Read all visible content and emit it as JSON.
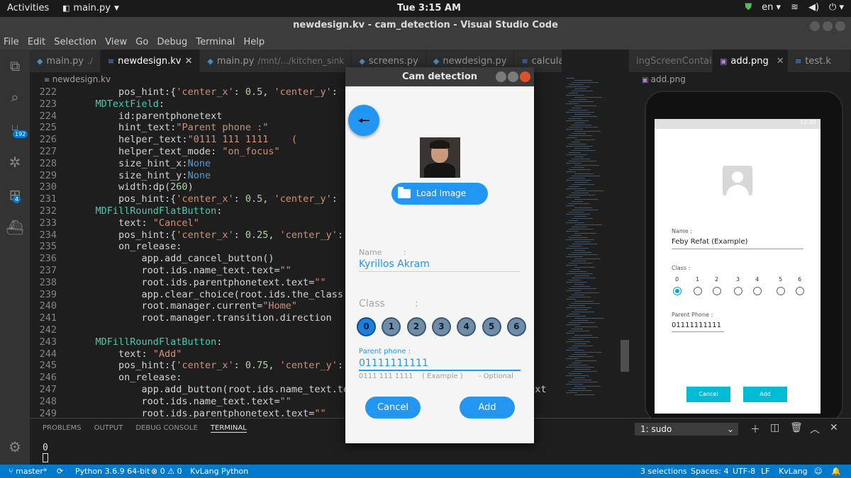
{
  "topbar": {
    "activities": "Activities",
    "app_name": "main.py",
    "clock": "Tue  3:15 AM",
    "language": "en"
  },
  "window": {
    "title": "newdesign.kv - cam_detection - Visual Studio Code"
  },
  "menu": [
    "File",
    "Edit",
    "Selection",
    "View",
    "Go",
    "Debug",
    "Terminal",
    "Help"
  ],
  "activity_badges": {
    "source_control": "192",
    "extensions": "4"
  },
  "tabs": [
    {
      "label": "main.py",
      "suffix": "./",
      "icon": "python-icon"
    },
    {
      "label": "newdesign.kv",
      "suffix": "",
      "icon": "kv-icon",
      "active": true
    },
    {
      "label": "main.py",
      "suffix": "/mnt/.../kitchen_sink",
      "icon": "python-icon"
    },
    {
      "label": "screens.py",
      "suffix": "",
      "icon": "python-icon"
    },
    {
      "label": "newdesign.py",
      "suffix": "",
      "icon": "python-icon"
    },
    {
      "label": "calculator.kv",
      "suffix": "",
      "icon": "kv-icon"
    }
  ],
  "breadcrumb": "newdesign.kv",
  "editor": {
    "lines": [
      {
        "n": "222",
        "indent": 8,
        "text": "pos_hint:{'center_x': 0.5, 'center_y':"
      },
      {
        "n": "223",
        "indent": 4,
        "text": "MDTextField:"
      },
      {
        "n": "224",
        "indent": 8,
        "text": "id:parentphonetext"
      },
      {
        "n": "225",
        "indent": 8,
        "text": "hint_text:\"Parent phone :\""
      },
      {
        "n": "226",
        "indent": 8,
        "text": "helper_text:\"0111 111 1111    ("
      },
      {
        "n": "227",
        "indent": 8,
        "text": "helper_text_mode: \"on_focus\""
      },
      {
        "n": "228",
        "indent": 8,
        "text": "size_hint_x:None"
      },
      {
        "n": "229",
        "indent": 8,
        "text": "size_hint_y:None"
      },
      {
        "n": "230",
        "indent": 8,
        "text": "width:dp(260)"
      },
      {
        "n": "231",
        "indent": 8,
        "text": "pos_hint:{'center_x': 0.5, 'center_y':"
      },
      {
        "n": "232",
        "indent": 4,
        "text": "MDFillRoundFlatButton:"
      },
      {
        "n": "233",
        "indent": 8,
        "text": "text: \"Cancel\""
      },
      {
        "n": "234",
        "indent": 8,
        "text": "pos_hint:{'center_x': 0.25, 'center_y':"
      },
      {
        "n": "235",
        "indent": 8,
        "text": "on_release:"
      },
      {
        "n": "236",
        "indent": 12,
        "text": "app.add_cancel_button()"
      },
      {
        "n": "237",
        "indent": 12,
        "text": "root.ids.name_text.text=\"\""
      },
      {
        "n": "238",
        "indent": 12,
        "text": "root.ids.parentphonetext.text=\"\""
      },
      {
        "n": "239",
        "indent": 12,
        "text": "app.clear_choice(root.ids.the_class"
      },
      {
        "n": "240",
        "indent": 12,
        "text": "root.manager.current=\"Home\""
      },
      {
        "n": "241",
        "indent": 12,
        "text": "root.manager.transition.direction"
      },
      {
        "n": "242",
        "indent": 0,
        "text": ""
      },
      {
        "n": "243",
        "indent": 4,
        "text": "MDFillRoundFlatButton:"
      },
      {
        "n": "244",
        "indent": 8,
        "text": "text: \"Add\""
      },
      {
        "n": "245",
        "indent": 8,
        "text": "pos_hint:{'center_x': 0.75, 'center_y':"
      },
      {
        "n": "246",
        "indent": 8,
        "text": "on_release:"
      },
      {
        "n": "247",
        "indent": 12,
        "text": "app.add_button(root.ids.name_text.text"
      },
      {
        "n": "248",
        "indent": 12,
        "text": "root.ids.name_text.text=\"\""
      },
      {
        "n": "249",
        "indent": 12,
        "text": "root.ids.parentphonetext.text=\"\""
      }
    ],
    "overflow_text": "text"
  },
  "right_pane": {
    "tabs": [
      {
        "label": "ingScreenContaint",
        "icon": ""
      },
      {
        "label": "add.png",
        "icon": "image-icon",
        "active": true
      },
      {
        "label": "test.k",
        "icon": "kv-icon"
      }
    ],
    "breadcrumb": "add.png",
    "preview": {
      "status_time": "12:30",
      "name_label": "Name :",
      "name_value": "Feby Refat (Example)",
      "class_label": "Class :",
      "class_numbers": [
        "0",
        "1",
        "2",
        "3",
        "4",
        "5",
        "6"
      ],
      "selected_class": "0",
      "phone_label": "Parent Phone :",
      "phone_value": "01111111111",
      "cancel": "Cancel",
      "add": "Add"
    }
  },
  "panel": {
    "tabs": [
      "PROBLEMS",
      "OUTPUT",
      "DEBUG CONSOLE",
      "TERMINAL"
    ],
    "active_tab": "TERMINAL",
    "terminal_select": "1: sudo",
    "terminal_output": "0"
  },
  "statusbar": {
    "branch": "master*",
    "python": "Python 3.6.9 64-bit",
    "errors": "0",
    "warnings": "0",
    "language_server": "KvLang Python",
    "selections": "3 selections",
    "spaces": "Spaces: 4",
    "encoding": "UTF-8",
    "eol": "LF",
    "mode": "KvLang"
  },
  "kivy_app": {
    "title": "Cam detection",
    "load_image": "Load Image",
    "name_label": "Name",
    "name_colon": ":",
    "name_value": "Kyrillos Akram",
    "class_label": "Class",
    "class_colon": ":",
    "class_buttons": [
      "0",
      "1",
      "2",
      "3",
      "4",
      "5",
      "6"
    ],
    "selected_class": "0",
    "phone_label": "Parent phone :",
    "phone_value": "01111111111",
    "phone_helper": "0111 111 1111    ( Example )       - Optional",
    "cancel": "Cancel",
    "add": "Add"
  }
}
